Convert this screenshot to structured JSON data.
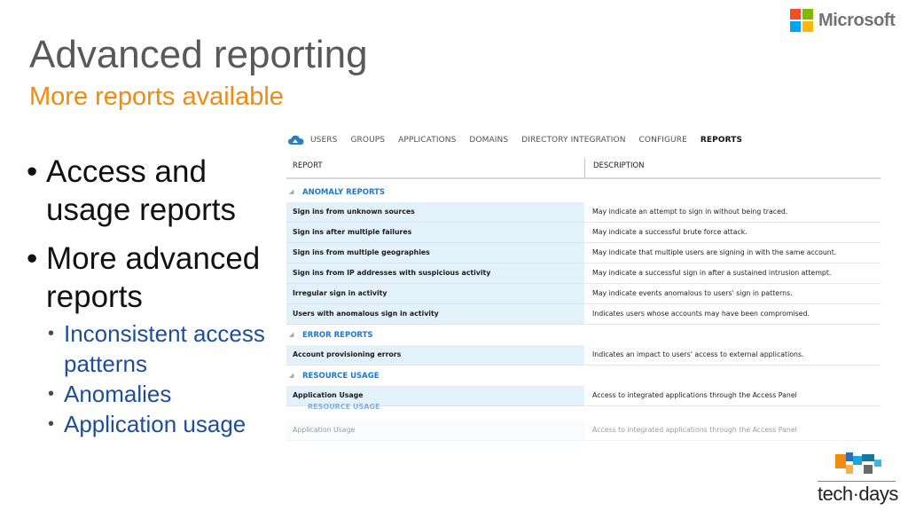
{
  "slide": {
    "title": "Advanced reporting",
    "subtitle": "More reports available",
    "brand": "Microsoft",
    "brand_colors": [
      "#f25022",
      "#7fba00",
      "#00a4ef",
      "#ffb900"
    ],
    "footer_logo": "tech·days"
  },
  "bullets": [
    {
      "text": "Access and usage reports"
    },
    {
      "text": "More advanced reports",
      "sub": [
        "Inconsistent access patterns",
        "Anomalies",
        "Application usage"
      ]
    }
  ],
  "portal": {
    "nav": [
      "USERS",
      "GROUPS",
      "APPLICATIONS",
      "DOMAINS",
      "DIRECTORY INTEGRATION",
      "CONFIGURE",
      "REPORTS"
    ],
    "active_nav": "REPORTS",
    "columns": {
      "report": "REPORT",
      "description": "DESCRIPTION"
    },
    "groups": [
      {
        "label": "ANOMALY REPORTS",
        "rows": [
          {
            "report": "Sign ins from unknown sources",
            "description": "May indicate an attempt to sign in without being traced."
          },
          {
            "report": "Sign ins after multiple failures",
            "description": "May indicate a successful brute force attack."
          },
          {
            "report": "Sign ins from multiple geographies",
            "description": "May indicate that multiple users are signing in with the same account."
          },
          {
            "report": "Sign ins from IP addresses with suspicious activity",
            "description": "May indicate a successful sign in after a sustained intrusion attempt."
          },
          {
            "report": "Irregular sign in activity",
            "description": "May indicate events anomalous to users' sign in patterns."
          },
          {
            "report": "Users with anomalous sign in activity",
            "description": "Indicates users whose accounts may have been compromised."
          }
        ]
      },
      {
        "label": "ERROR REPORTS",
        "rows": [
          {
            "report": "Account provisioning errors",
            "description": "Indicates an impact to users' access to external applications."
          }
        ]
      },
      {
        "label": "RESOURCE USAGE",
        "rows": [
          {
            "report": "Application Usage",
            "description": "Access to integrated applications through the Access Panel"
          }
        ]
      }
    ],
    "reflection": {
      "label": "RESOURCE USAGE",
      "report": "Application Usage",
      "description": "Access to integrated applications through the Access Panel"
    }
  }
}
